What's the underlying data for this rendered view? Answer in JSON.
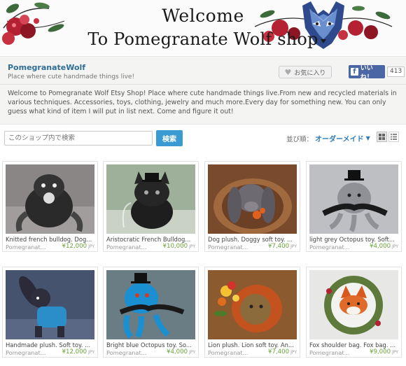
{
  "banner": {
    "line1": "Welcome",
    "line2": "To Pomegranate Wolf shop"
  },
  "shop": {
    "name": "PomegranateWolf",
    "tagline": "Place where cute handmade things live!",
    "favorite_label": "お気に入り",
    "like_label": "いいね！",
    "like_count": "413",
    "description": "Welcome to Pomegranate Wolf Etsy Shop! Place where cute handmade things live.From new and recycled materials in various techniques. Accessories, toys, clothing, jewelry and much more.Every day for something new. You can only guess what kind of item I will put in list next. Come and figure it out!"
  },
  "search": {
    "placeholder": "このショップ内で検索",
    "button_label": "検索",
    "sort_label": "並び順：",
    "sort_value": "オーダーメイド"
  },
  "colors": {
    "accent": "#3a9bd2",
    "link": "#2f6e96",
    "price": "#6aa33a",
    "facebook": "#4a66a5"
  },
  "products": [
    {
      "title": "Knitted french bulldog. Dog...",
      "shop": "Pomegranat...",
      "price": "¥12,000",
      "currency": "JPY"
    },
    {
      "title": "Aristocratic French Bulldog...",
      "shop": "Pomegranat...",
      "price": "¥10,000",
      "currency": "JPY"
    },
    {
      "title": "Dog plush. Doggy soft toy. ...",
      "shop": "Pomegranat...",
      "price": "¥7,400",
      "currency": "JPY"
    },
    {
      "title": "light grey Octopus toy. Soft...",
      "shop": "Pomegranat...",
      "price": "¥4,000",
      "currency": "JPY"
    },
    {
      "title": "Handmade plush. Soft toy. ...",
      "shop": "Pomegranat...",
      "price": "¥12,000",
      "currency": "JPY"
    },
    {
      "title": "Bright blue Octopus toy. So...",
      "shop": "Pomegranat...",
      "price": "¥4,000",
      "currency": "JPY"
    },
    {
      "title": "Lion plush. Lion soft toy. An...",
      "shop": "Pomegranat...",
      "price": "¥7,400",
      "currency": "JPY"
    },
    {
      "title": "Fox shoulder bag. Fox bag. ...",
      "shop": "Pomegranat...",
      "price": "¥9,000",
      "currency": "JPY"
    }
  ]
}
